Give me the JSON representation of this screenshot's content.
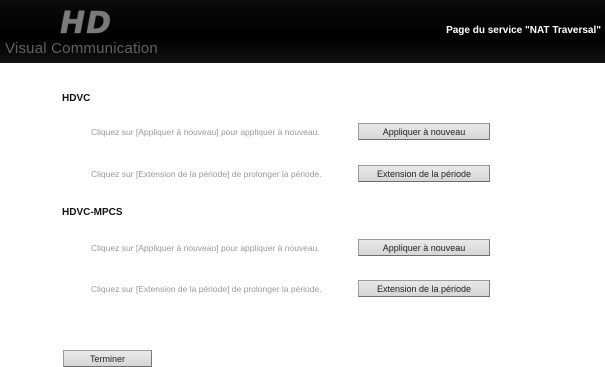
{
  "header": {
    "logo_mark": "HD",
    "logo_text": "Visual Communication",
    "page_title": "Page du service \"NAT Traversal\""
  },
  "sections": [
    {
      "title": "HDVC",
      "rows": [
        {
          "text": "Cliquez sur [Appliquer à nouveau] pour appliquer à nouveau.",
          "button": "Appliquer à nouveau"
        },
        {
          "text": "Cliquez sur [Extension de la période] de prolonger la période.",
          "button": "Extension de la période"
        }
      ]
    },
    {
      "title": "HDVC-MPCS",
      "rows": [
        {
          "text": "Cliquez sur [Appliquer à nouveau] pour appliquer à nouveau.",
          "button": "Appliquer à nouveau"
        },
        {
          "text": "Cliquez sur [Extension de la période] de prolonger la période.",
          "button": "Extension de la période"
        }
      ]
    }
  ],
  "footer": {
    "finish_label": "Terminer"
  }
}
